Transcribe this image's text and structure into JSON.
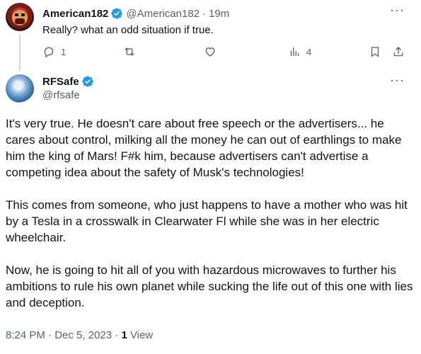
{
  "reply_tweet": {
    "display_name": "American182",
    "handle": "@American182",
    "separator": "·",
    "time": "19m",
    "text": "Really? what an odd situation if true.",
    "more_icon": "more-horizontal-icon",
    "actions": {
      "reply_count": "1",
      "retweet_count": "",
      "like_count": "",
      "views_count": "4"
    }
  },
  "main_tweet": {
    "display_name": "RFSafe",
    "handle": "@rfsafe",
    "paragraphs": [
      "It's very true.  He doesn't care about free speech or the advertisers... he cares about control, milking all the money he can out of earthlings to make him the king of Mars!  F#k him, because advertisers can't advertise a competing idea about the safety of Musk's technologies!",
      "This comes from someone, who just happens to have a mother who was hit by a Tesla in a crosswalk in Clearwater Fl while she was in her electric wheelchair.",
      "Now, he is going to hit all of you with hazardous microwaves to further his ambitions to rule his own planet while sucking the life out of this one with lies and deception."
    ],
    "timestamp": "8:24 PM · Dec 5, 2023",
    "meta_separator": " · ",
    "views_count": "1",
    "views_label": "View"
  },
  "colors": {
    "verified_blue": "#1d9bf0",
    "secondary_text": "#536471",
    "primary_text": "#0f1419",
    "thread_line": "#cfd9de"
  }
}
